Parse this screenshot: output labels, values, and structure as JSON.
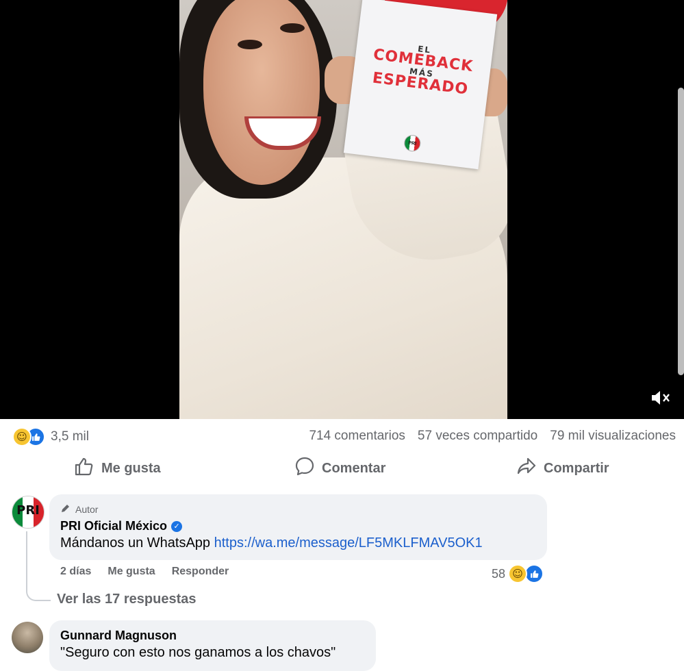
{
  "video": {
    "sign_line1": "EL",
    "sign_line2": "COMEBACK",
    "sign_line3": "MÁS",
    "sign_line4": "ESPERADO",
    "sign_logo": "PRI",
    "mute_icon": "volume-muted-icon"
  },
  "stats": {
    "reaction_count": "3,5 mil",
    "comments": "714 comentarios",
    "shares": "57 veces compartido",
    "views": "79 mil visualizaciones"
  },
  "actions": {
    "like": "Me gusta",
    "comment": "Comentar",
    "share": "Compartir"
  },
  "comments": [
    {
      "author_tag": "Autor",
      "name": "PRI Oficial México",
      "verified": true,
      "text": "Mándanos un WhatsApp ",
      "link": "https://wa.me/message/LF5MKLFMAV5OK1",
      "time": "2 días",
      "like": "Me gusta",
      "reply": "Responder",
      "reaction_count": "58",
      "avatar_letters": "PRI",
      "view_replies": "Ver las 17 respuestas"
    },
    {
      "name": "Gunnard Magnuson",
      "text": "\"Seguro con esto nos ganamos a los chavos\""
    }
  ],
  "colors": {
    "accent": "#1b74e4",
    "link": "#1b5fcc",
    "muted_text": "#65676b",
    "bubble": "#f0f2f5"
  }
}
